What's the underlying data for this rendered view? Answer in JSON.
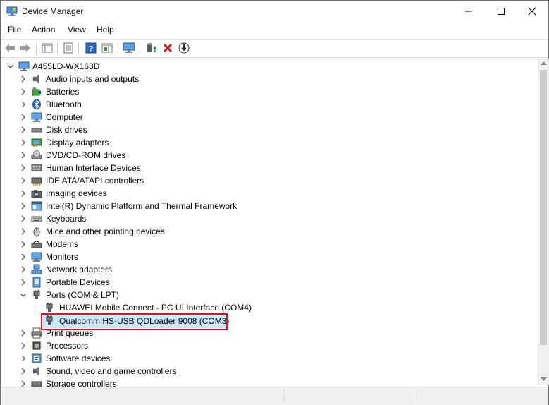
{
  "window": {
    "title": "Device Manager"
  },
  "menu": [
    "File",
    "Action",
    "View",
    "Help"
  ],
  "tree": {
    "root": "A455LD-WX163D",
    "categories": [
      {
        "label": "Audio inputs and outputs",
        "icon": "speaker-icon"
      },
      {
        "label": "Batteries",
        "icon": "battery-icon"
      },
      {
        "label": "Bluetooth",
        "icon": "bluetooth-icon"
      },
      {
        "label": "Computer",
        "icon": "computer-icon"
      },
      {
        "label": "Disk drives",
        "icon": "disk-drive-icon"
      },
      {
        "label": "Display adapters",
        "icon": "display-adapter-icon"
      },
      {
        "label": "DVD/CD-ROM drives",
        "icon": "dvd-drive-icon"
      },
      {
        "label": "Human Interface Devices",
        "icon": "hid-icon"
      },
      {
        "label": "IDE ATA/ATAPI controllers",
        "icon": "ide-controller-icon"
      },
      {
        "label": "Imaging devices",
        "icon": "camera-icon"
      },
      {
        "label": "Intel(R) Dynamic Platform and Thermal Framework",
        "icon": "intel-framework-icon"
      },
      {
        "label": "Keyboards",
        "icon": "keyboard-icon"
      },
      {
        "label": "Mice and other pointing devices",
        "icon": "mouse-icon"
      },
      {
        "label": "Modems",
        "icon": "modem-icon"
      },
      {
        "label": "Monitors",
        "icon": "monitor-icon"
      },
      {
        "label": "Network adapters",
        "icon": "network-adapter-icon"
      },
      {
        "label": "Portable Devices",
        "icon": "portable-device-icon"
      },
      {
        "label": "Ports (COM & LPT)",
        "icon": "port-icon"
      },
      {
        "label": "Print queues",
        "icon": "printer-icon"
      },
      {
        "label": "Processors",
        "icon": "processor-icon"
      },
      {
        "label": "Software devices",
        "icon": "software-device-icon"
      },
      {
        "label": "Sound, video and game controllers",
        "icon": "sound-controller-icon"
      },
      {
        "label": "Storage controllers",
        "icon": "storage-controller-icon"
      }
    ],
    "ports_children": [
      "HUAWEI Mobile Connect - PC UI Interface (COM4)",
      "Qualcomm HS-USB QDLoader 9008 (COM3)"
    ]
  }
}
